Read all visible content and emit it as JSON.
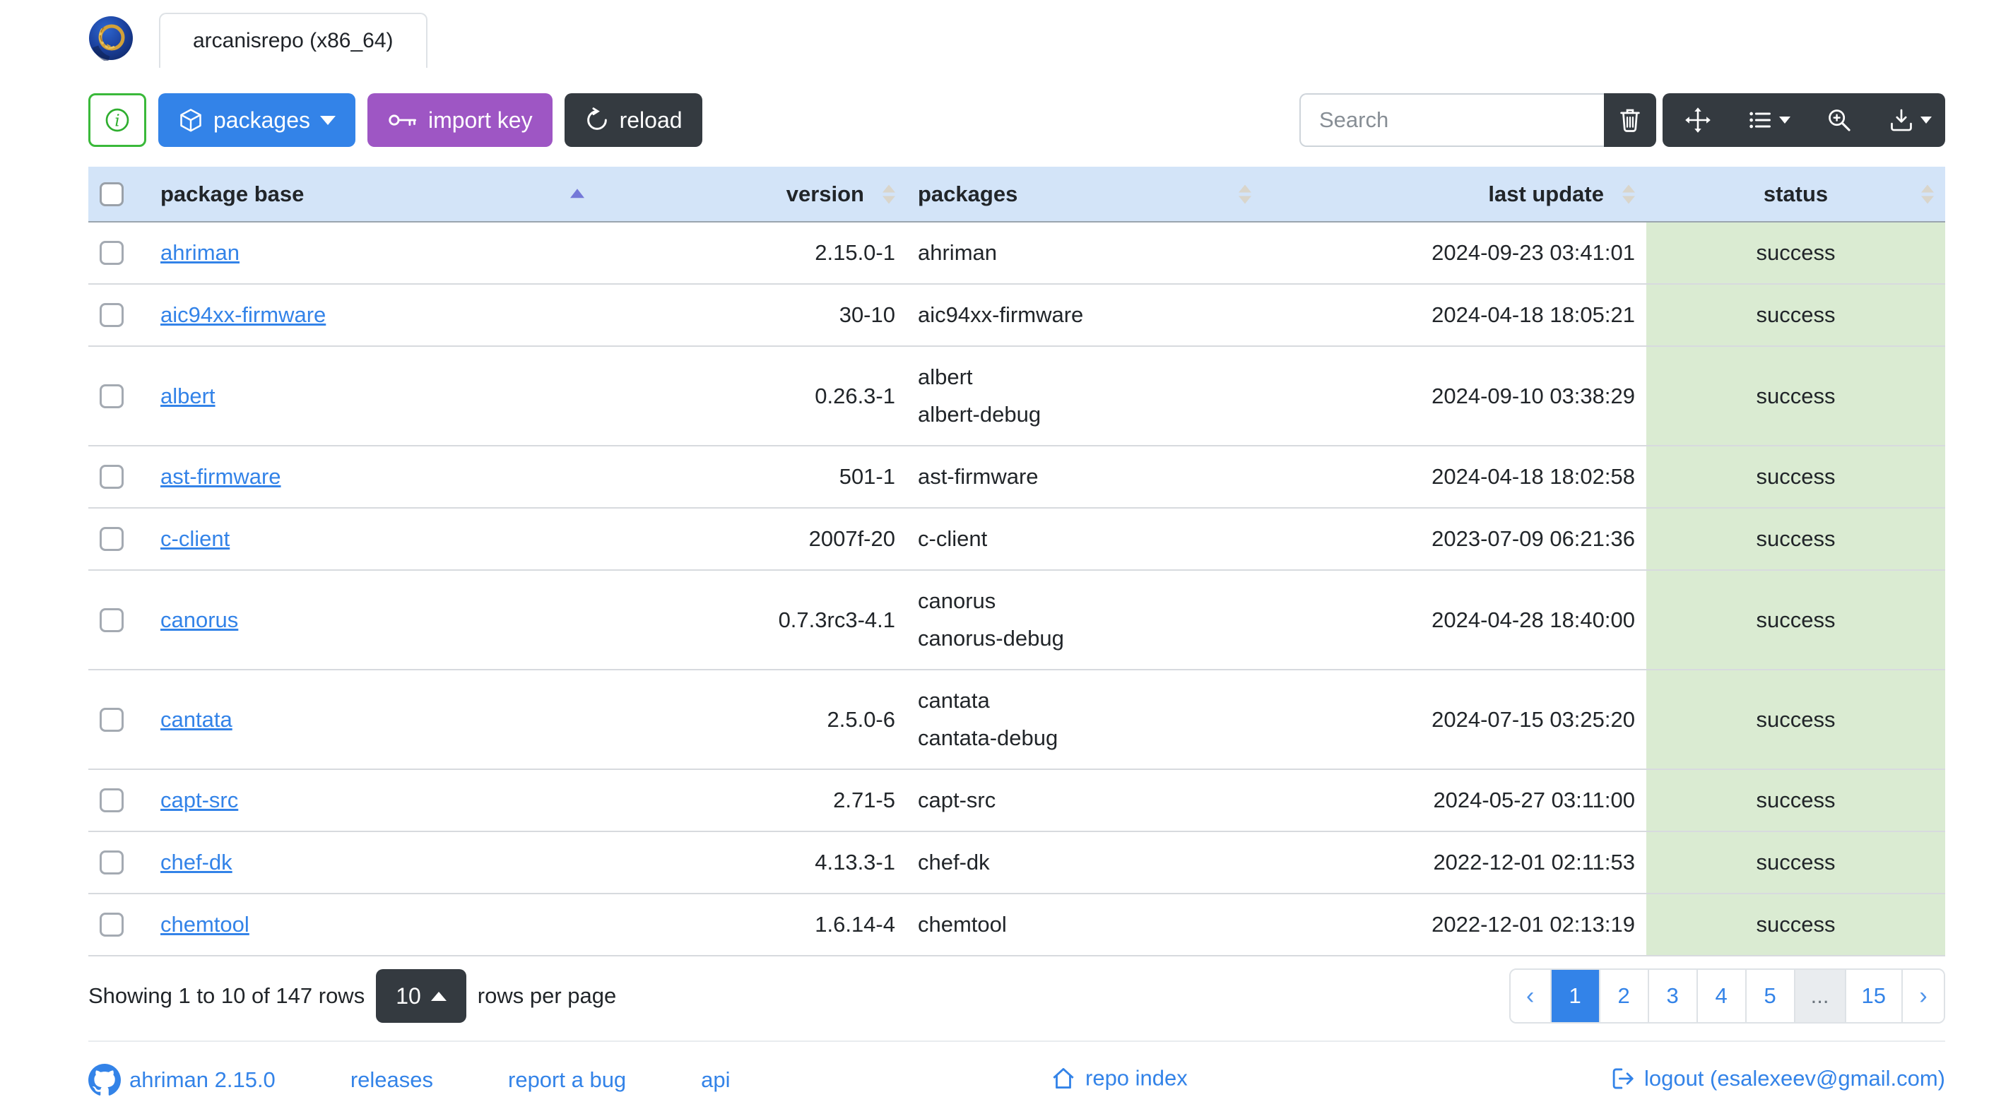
{
  "window": {
    "tab_title": "arcanisrepo (x86_64)"
  },
  "toolbar": {
    "packages_button": "packages",
    "import_key_button": "import key",
    "reload_button": "reload",
    "search_placeholder": "Search"
  },
  "table": {
    "columns": {
      "base": "package base",
      "version": "version",
      "packages": "packages",
      "last_update": "last update",
      "status": "status"
    },
    "sorted_column": "package base",
    "sort_direction": "asc",
    "rows": [
      {
        "base": "ahriman",
        "version": "2.15.0-1",
        "packages": [
          "ahriman"
        ],
        "last_update": "2024-09-23 03:41:01",
        "status": "success"
      },
      {
        "base": "aic94xx-firmware",
        "version": "30-10",
        "packages": [
          "aic94xx-firmware"
        ],
        "last_update": "2024-04-18 18:05:21",
        "status": "success"
      },
      {
        "base": "albert",
        "version": "0.26.3-1",
        "packages": [
          "albert",
          "albert-debug"
        ],
        "last_update": "2024-09-10 03:38:29",
        "status": "success"
      },
      {
        "base": "ast-firmware",
        "version": "501-1",
        "packages": [
          "ast-firmware"
        ],
        "last_update": "2024-04-18 18:02:58",
        "status": "success"
      },
      {
        "base": "c-client",
        "version": "2007f-20",
        "packages": [
          "c-client"
        ],
        "last_update": "2023-07-09 06:21:36",
        "status": "success"
      },
      {
        "base": "canorus",
        "version": "0.7.3rc3-4.1",
        "packages": [
          "canorus",
          "canorus-debug"
        ],
        "last_update": "2024-04-28 18:40:00",
        "status": "success"
      },
      {
        "base": "cantata",
        "version": "2.5.0-6",
        "packages": [
          "cantata",
          "cantata-debug"
        ],
        "last_update": "2024-07-15 03:25:20",
        "status": "success"
      },
      {
        "base": "capt-src",
        "version": "2.71-5",
        "packages": [
          "capt-src"
        ],
        "last_update": "2024-05-27 03:11:00",
        "status": "success"
      },
      {
        "base": "chef-dk",
        "version": "4.13.3-1",
        "packages": [
          "chef-dk"
        ],
        "last_update": "2022-12-01 02:11:53",
        "status": "success"
      },
      {
        "base": "chemtool",
        "version": "1.6.14-4",
        "packages": [
          "chemtool"
        ],
        "last_update": "2022-12-01 02:13:19",
        "status": "success"
      }
    ]
  },
  "pagination": {
    "summary": "Showing 1 to 10 of 147 rows",
    "page_size": "10",
    "rows_per_page_label": "rows per page",
    "prev_label": "‹",
    "next_label": "›",
    "pages": [
      "1",
      "2",
      "3",
      "4",
      "5",
      "...",
      "15"
    ],
    "active_page": "1"
  },
  "footer": {
    "version_link": "ahriman 2.15.0",
    "releases_link": "releases",
    "report_bug_link": "report a bug",
    "api_link": "api",
    "repo_index_link": "repo index",
    "logout_link": "logout (esalexeev@gmail.com)"
  },
  "icons": {
    "logo": "ahriman-logo",
    "info": "info-circle-icon",
    "packages": "box-icon",
    "import_key": "key-icon",
    "reload": "arrow-clockwise-icon",
    "clear_search": "trash-icon",
    "fullscreen": "arrows-move-icon",
    "columns": "list-icon",
    "advanced_search": "zoom-in-icon",
    "export": "download-icon",
    "github": "github-icon",
    "repo_index": "house-icon",
    "logout": "box-arrow-right-icon"
  },
  "colors": {
    "accent_blue": "#3383e8",
    "purple": "#9e56c4",
    "dark": "#343a40",
    "green_outline": "#3ab93a",
    "table_header_bg": "#d3e4f8",
    "status_success_bg": "#daebd2"
  }
}
